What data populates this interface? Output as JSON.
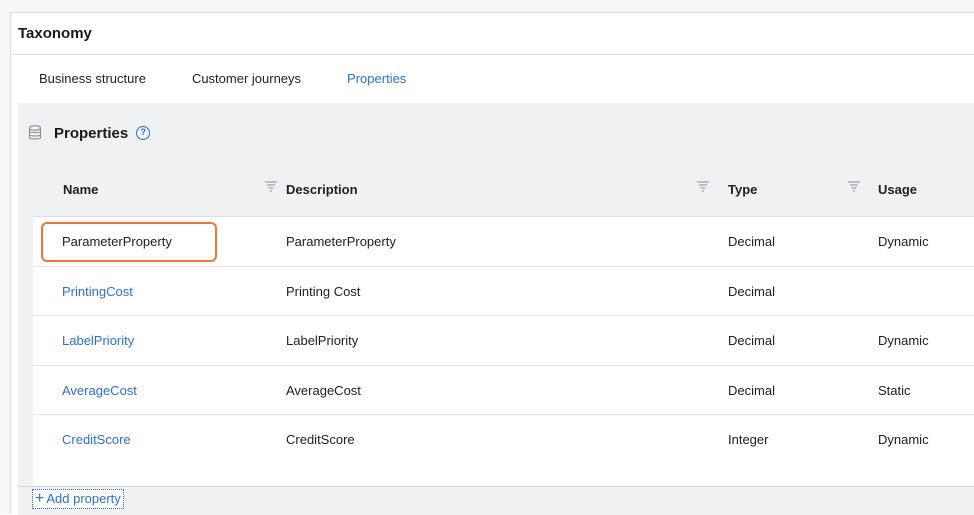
{
  "panel": {
    "title": "Taxonomy"
  },
  "tabs": [
    {
      "label": "Business structure",
      "active": false
    },
    {
      "label": "Customer journeys",
      "active": false
    },
    {
      "label": "Properties",
      "active": true
    }
  ],
  "section": {
    "title": "Properties",
    "help_icon": "question-circle-icon",
    "icon": "database-icon"
  },
  "table": {
    "columns": [
      "Name",
      "Description",
      "Type",
      "Usage"
    ],
    "rows": [
      {
        "name": "ParameterProperty",
        "description": "ParameterProperty",
        "type": "Decimal",
        "usage": "Dynamic",
        "highlighted": true
      },
      {
        "name": "PrintingCost",
        "description": "Printing Cost",
        "type": "Decimal",
        "usage": ""
      },
      {
        "name": "LabelPriority",
        "description": "LabelPriority",
        "type": "Decimal",
        "usage": "Dynamic"
      },
      {
        "name": "AverageCost",
        "description": "AverageCost",
        "type": "Decimal",
        "usage": "Static"
      },
      {
        "name": "CreditScore",
        "description": "CreditScore",
        "type": "Integer",
        "usage": "Dynamic"
      }
    ]
  },
  "actions": {
    "add_property": "Add property"
  },
  "colors": {
    "accent": "#2f6ed0",
    "highlight": "#e4793f",
    "content_bg": "#eff1f3"
  }
}
